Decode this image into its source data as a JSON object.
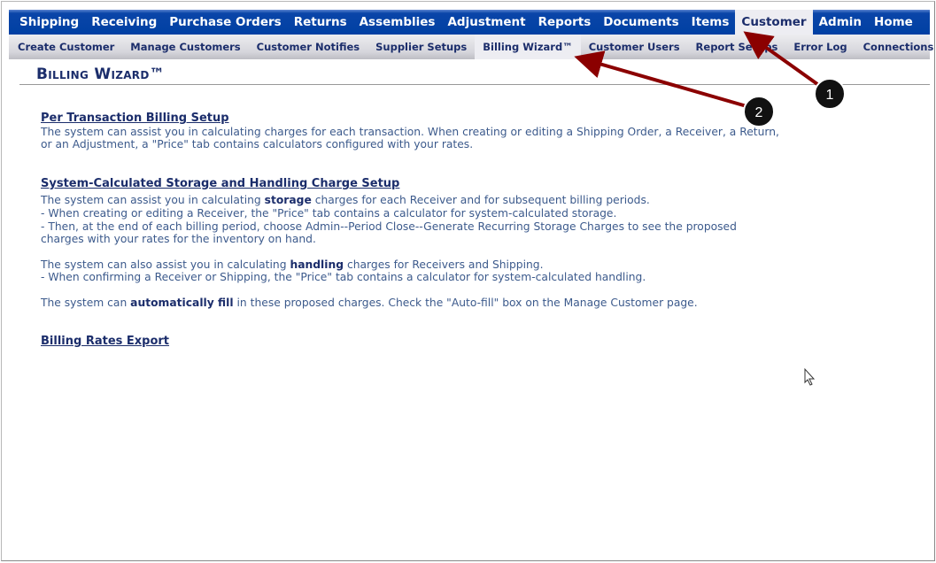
{
  "top_nav": [
    "Shipping",
    "Receiving",
    "Purchase Orders",
    "Returns",
    "Assemblies",
    "Adjustment",
    "Reports",
    "Documents",
    "Items",
    "Customer",
    "Admin",
    "Home"
  ],
  "top_active": "Customer",
  "sub_nav": [
    "Create Customer",
    "Manage Customers",
    "Customer Notifies",
    "Supplier Setups",
    "Billing Wizard™",
    "Customer Users",
    "Report Setups",
    "Error Log",
    "Connections"
  ],
  "sub_active": "Billing Wizard™",
  "page_title": "Billing Wizard™",
  "sections": {
    "per_transaction": {
      "link": "Per Transaction Billing Setup",
      "line1": "The system can assist you in calculating charges for each transaction. When creating or editing a Shipping Order, a Receiver, a Return,",
      "line2": "or an Adjustment, a \"Price\" tab contains calculators configured with your rates."
    },
    "storage": {
      "link": "System-Calculated Storage and Handling Charge Setup",
      "p1a": "The system can assist you in calculating ",
      "p1b": "storage",
      "p1c": " charges for each Receiver and for subsequent billing periods.",
      "p2": "- When creating or editing a Receiver, the \"Price\" tab contains a calculator for system-calculated storage.",
      "p3": "- Then, at the end of each billing period, choose Admin--Period Close--Generate Recurring Storage Charges to see the proposed",
      "p4": "charges with your rates for the inventory on hand.",
      "h1a": "The system can also assist you in calculating ",
      "h1b": "handling",
      "h1c": " charges for Receivers and Shipping.",
      "h2": "- When confirming a Receiver or Shipping, the \"Price\" tab contains a calculator for system-calculated handling.",
      "a1": "The system can ",
      "a2": "automatically fill",
      "a3": " in these proposed charges. Check the \"Auto-fill\" box on the Manage Customer page."
    },
    "export": {
      "link": "Billing Rates Export"
    }
  },
  "annotations": [
    "1",
    "2"
  ],
  "colors": {
    "nav_blue": "#0040a3",
    "heading": "#1b2d6b",
    "text": "#3c5a8c",
    "arrow": "#8b0000"
  }
}
